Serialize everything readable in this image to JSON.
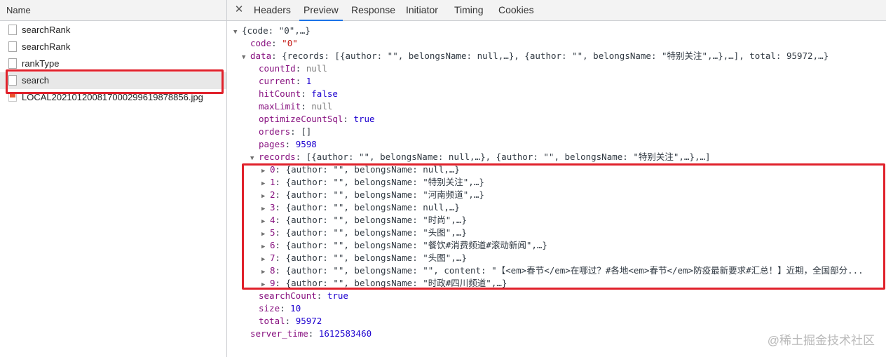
{
  "left_panel": {
    "header": "Name",
    "requests": [
      {
        "name": "searchRank",
        "type": "doc"
      },
      {
        "name": "searchRank",
        "type": "doc"
      },
      {
        "name": "rankType",
        "type": "doc"
      },
      {
        "name": "search",
        "type": "doc",
        "selected": true
      },
      {
        "name": "LOCAL2021012008170002996198788​56.jpg",
        "type": "image"
      }
    ]
  },
  "tabs": {
    "close_icon": "close-icon",
    "items": [
      "Headers",
      "Preview",
      "Response",
      "Initiator",
      "Timing",
      "Cookies"
    ],
    "active": "Preview"
  },
  "preview": {
    "lines": [
      {
        "indent": 0,
        "arrow": "▼",
        "parts": [
          [
            "p",
            "{code: \"0\",…}"
          ]
        ]
      },
      {
        "indent": 1,
        "arrow": "",
        "parts": [
          [
            "k",
            "code"
          ],
          [
            "p",
            ": "
          ],
          [
            "s",
            "\"0\""
          ]
        ]
      },
      {
        "indent": 1,
        "arrow": "▼",
        "parts": [
          [
            "k",
            "data"
          ],
          [
            "p",
            ": {records: [{author: \"\", belongsName: null,…}, {author: \"\", belongsName: \"特别关注\",…},…], total: 95972,…}"
          ]
        ]
      },
      {
        "indent": 2,
        "arrow": "",
        "parts": [
          [
            "k",
            "countId"
          ],
          [
            "p",
            ": "
          ],
          [
            "g",
            "null"
          ]
        ]
      },
      {
        "indent": 2,
        "arrow": "",
        "parts": [
          [
            "k",
            "current"
          ],
          [
            "p",
            ": "
          ],
          [
            "n",
            "1"
          ]
        ]
      },
      {
        "indent": 2,
        "arrow": "",
        "parts": [
          [
            "k",
            "hitCount"
          ],
          [
            "p",
            ": "
          ],
          [
            "n",
            "false"
          ]
        ]
      },
      {
        "indent": 2,
        "arrow": "",
        "parts": [
          [
            "k",
            "maxLimit"
          ],
          [
            "p",
            ": "
          ],
          [
            "g",
            "null"
          ]
        ]
      },
      {
        "indent": 2,
        "arrow": "",
        "parts": [
          [
            "k",
            "optimizeCountSql"
          ],
          [
            "p",
            ": "
          ],
          [
            "n",
            "true"
          ]
        ]
      },
      {
        "indent": 2,
        "arrow": "",
        "parts": [
          [
            "k",
            "orders"
          ],
          [
            "p",
            ": []"
          ]
        ]
      },
      {
        "indent": 2,
        "arrow": "",
        "parts": [
          [
            "k",
            "pages"
          ],
          [
            "p",
            ": "
          ],
          [
            "n",
            "9598"
          ]
        ]
      },
      {
        "indent": 2,
        "arrow": "▼",
        "parts": [
          [
            "k",
            "records"
          ],
          [
            "p",
            ": [{author: \"\", belongsName: null,…}, {author: \"\", belongsName: \"特别关注\",…},…]"
          ]
        ]
      },
      {
        "indent": 3,
        "arrow": "▶",
        "parts": [
          [
            "k",
            "0"
          ],
          [
            "p",
            ": {author: \"\", belongsName: null,…}"
          ]
        ]
      },
      {
        "indent": 3,
        "arrow": "▶",
        "parts": [
          [
            "k",
            "1"
          ],
          [
            "p",
            ": {author: \"\", belongsName: \"特别关注\",…}"
          ]
        ]
      },
      {
        "indent": 3,
        "arrow": "▶",
        "parts": [
          [
            "k",
            "2"
          ],
          [
            "p",
            ": {author: \"\", belongsName: \"河南频道\",…}"
          ]
        ]
      },
      {
        "indent": 3,
        "arrow": "▶",
        "parts": [
          [
            "k",
            "3"
          ],
          [
            "p",
            ": {author: \"\", belongsName: null,…}"
          ]
        ]
      },
      {
        "indent": 3,
        "arrow": "▶",
        "parts": [
          [
            "k",
            "4"
          ],
          [
            "p",
            ": {author: \"\", belongsName: \"时尚\",…}"
          ]
        ]
      },
      {
        "indent": 3,
        "arrow": "▶",
        "parts": [
          [
            "k",
            "5"
          ],
          [
            "p",
            ": {author: \"\", belongsName: \"头图\",…}"
          ]
        ]
      },
      {
        "indent": 3,
        "arrow": "▶",
        "parts": [
          [
            "k",
            "6"
          ],
          [
            "p",
            ": {author: \"\", belongsName: \"餐饮#消费频道#滚动新闻\",…}"
          ]
        ]
      },
      {
        "indent": 3,
        "arrow": "▶",
        "parts": [
          [
            "k",
            "7"
          ],
          [
            "p",
            ": {author: \"\", belongsName: \"头图\",…}"
          ]
        ]
      },
      {
        "indent": 3,
        "arrow": "▶",
        "parts": [
          [
            "k",
            "8"
          ],
          [
            "p",
            ": {author: \"\", belongsName: \"\", content: \"【<em>春节</em>在哪过？#各地<em>春节</em>防疫最新要求#汇总！】近期，全国部分..."
          ]
        ]
      },
      {
        "indent": 3,
        "arrow": "▶",
        "parts": [
          [
            "k",
            "9"
          ],
          [
            "p",
            ": {author: \"\", belongsName: \"时政#四川频道\",…}"
          ]
        ]
      },
      {
        "indent": 2,
        "arrow": "",
        "parts": [
          [
            "k",
            "searchCount"
          ],
          [
            "p",
            ": "
          ],
          [
            "n",
            "true"
          ]
        ]
      },
      {
        "indent": 2,
        "arrow": "",
        "parts": [
          [
            "k",
            "size"
          ],
          [
            "p",
            ": "
          ],
          [
            "n",
            "10"
          ]
        ]
      },
      {
        "indent": 2,
        "arrow": "",
        "parts": [
          [
            "k",
            "total"
          ],
          [
            "p",
            ": "
          ],
          [
            "n",
            "95972"
          ]
        ]
      },
      {
        "indent": 1,
        "arrow": "",
        "parts": [
          [
            "k",
            "server_time"
          ],
          [
            "p",
            ": "
          ],
          [
            "n",
            "1612583460"
          ]
        ]
      }
    ]
  },
  "watermark": "@稀土掘金技术社区"
}
